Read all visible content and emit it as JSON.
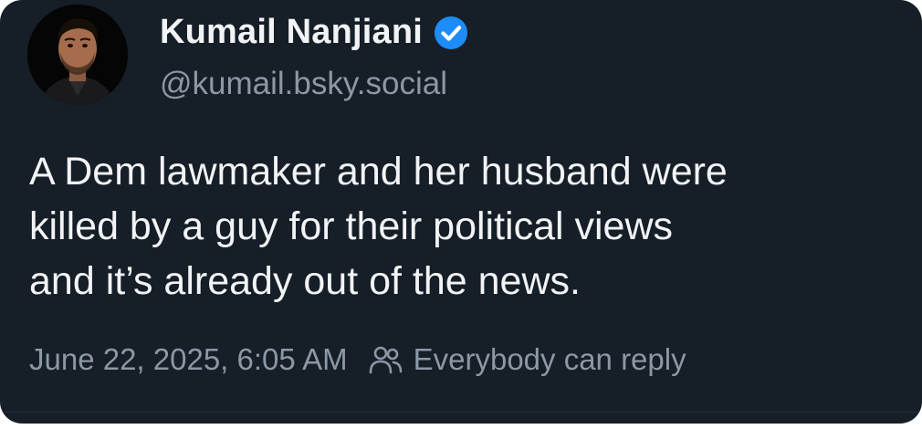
{
  "author": {
    "display_name": "Kumail Nanjiani",
    "handle": "@kumail.bsky.social",
    "verified": true,
    "avatar_icon": "profile-photo-avatar"
  },
  "post": {
    "text_lines": [
      "A Dem lawmaker and her husband were",
      "killed by a guy for their political views",
      "and it’s already out of the news."
    ],
    "timestamp": "June 22, 2025, 6:05 AM",
    "reply_setting": "Everybody can reply",
    "reply_icon": "people-icon"
  },
  "colors": {
    "background": "#161e27",
    "primary_text": "#f1f3f5",
    "secondary_text": "#8b98a5",
    "verified_badge": "#1d8cf8"
  }
}
